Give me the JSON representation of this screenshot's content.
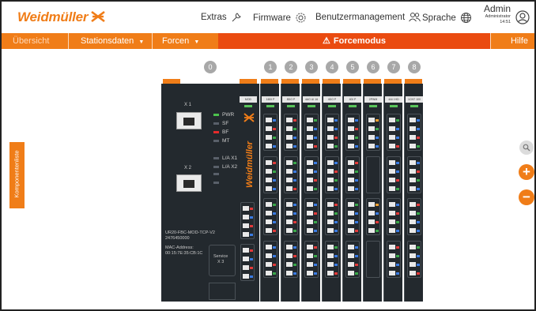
{
  "header": {
    "logo": "Weidmüller",
    "menu": [
      {
        "label": "Extras",
        "icon": "wrench-icon"
      },
      {
        "label": "Firmware",
        "icon": "firmware-gear-icon"
      },
      {
        "label": "Benutzermanagement",
        "icon": "users-icon"
      },
      {
        "label": "Sprache",
        "icon": "globe-icon"
      }
    ],
    "user": {
      "name": "Admin",
      "role": "Administrator",
      "time": "14:51"
    }
  },
  "nav": {
    "overview": "Übersicht",
    "station_data": "Stationsdaten",
    "force": "Forcen",
    "force_mode": "Forcemodus",
    "help": "Hilfe"
  },
  "side_tab": {
    "label": "Komponentenliste"
  },
  "slots": [
    "0",
    "1",
    "2",
    "3",
    "4",
    "5",
    "6",
    "7",
    "8"
  ],
  "station": {
    "head": {
      "port1_label": "X 1",
      "port2_label": "X 2",
      "leds": [
        "PWR",
        "SF",
        "BF",
        "MT",
        "L/A X1",
        "L/A X2"
      ],
      "model": "UR20-FBC-MOD-TCP-V2",
      "part_no": "2476450000",
      "mac_label": "MAC-Address:",
      "mac": "00:15:7E:35:CB:1C",
      "service": "Service",
      "service_port": "X 3"
    },
    "modules": [
      {
        "label": "MOD"
      },
      {
        "label": "16DI P"
      },
      {
        "label": "8DO P"
      },
      {
        "label": "4AO UI 16"
      },
      {
        "label": "4DO P"
      },
      {
        "label": "4DI P"
      },
      {
        "label": "2PWM"
      },
      {
        "label": "4AI I HD"
      },
      {
        "label": "1CNT 100"
      }
    ]
  },
  "controls": {
    "zoom_in": "+",
    "zoom_out": "−"
  },
  "colors": {
    "brand_orange": "#f07d18",
    "force_red": "#ea4b10",
    "module_body": "#23292e"
  }
}
